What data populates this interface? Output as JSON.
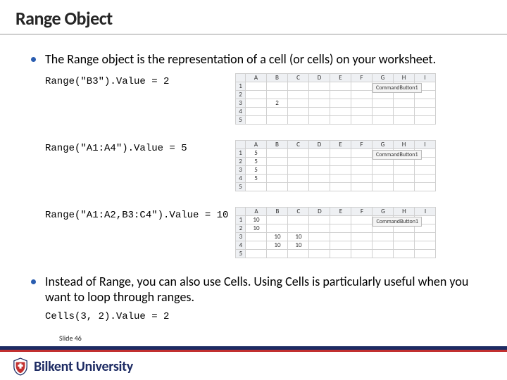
{
  "title": "Range Object",
  "bullets": {
    "b1": "The Range object is the representation of a cell (or cells) on your worksheet.",
    "b2": "Instead of Range, you can also use Cells. Using Cells is particularly useful when you want to loop through ranges."
  },
  "codes": {
    "c1": "Range(\"B3\").Value = 2",
    "c2": "Range(\"A1:A4\").Value = 5",
    "c3": "Range(\"A1:A2,B3:C4\").Value = 10",
    "c4": "Cells(3, 2).Value = 2"
  },
  "columns": [
    "A",
    "B",
    "C",
    "D",
    "E",
    "F",
    "G",
    "H",
    "I"
  ],
  "rows": [
    "1",
    "2",
    "3",
    "4",
    "5"
  ],
  "sheet1": {
    "r1": [
      "",
      "",
      "",
      "",
      "",
      "",
      "",
      "",
      ""
    ],
    "r2": [
      "",
      "",
      "",
      "",
      "",
      "",
      "",
      "",
      ""
    ],
    "r3": [
      "",
      "2",
      "",
      "",
      "",
      "",
      "",
      "",
      ""
    ],
    "r4": [
      "",
      "",
      "",
      "",
      "",
      "",
      "",
      "",
      ""
    ],
    "r5": [
      "",
      "",
      "",
      "",
      "",
      "",
      "",
      "",
      ""
    ]
  },
  "sheet2": {
    "r1": [
      "5",
      "",
      "",
      "",
      "",
      "",
      "",
      "",
      ""
    ],
    "r2": [
      "5",
      "",
      "",
      "",
      "",
      "",
      "",
      "",
      ""
    ],
    "r3": [
      "5",
      "",
      "",
      "",
      "",
      "",
      "",
      "",
      ""
    ],
    "r4": [
      "5",
      "",
      "",
      "",
      "",
      "",
      "",
      "",
      ""
    ],
    "r5": [
      "",
      "",
      "",
      "",
      "",
      "",
      "",
      "",
      ""
    ]
  },
  "sheet3": {
    "r1": [
      "10",
      "",
      "",
      "",
      "",
      "",
      "",
      "",
      ""
    ],
    "r2": [
      "10",
      "",
      "",
      "",
      "",
      "",
      "",
      "",
      ""
    ],
    "r3": [
      "",
      "10",
      "10",
      "",
      "",
      "",
      "",
      "",
      ""
    ],
    "r4": [
      "",
      "10",
      "10",
      "",
      "",
      "",
      "",
      "",
      ""
    ],
    "r5": [
      "",
      "",
      "",
      "",
      "",
      "",
      "",
      "",
      ""
    ]
  },
  "button_label": "CommandButton1",
  "slide_number": "Slide 46",
  "university": "Bilkent University"
}
